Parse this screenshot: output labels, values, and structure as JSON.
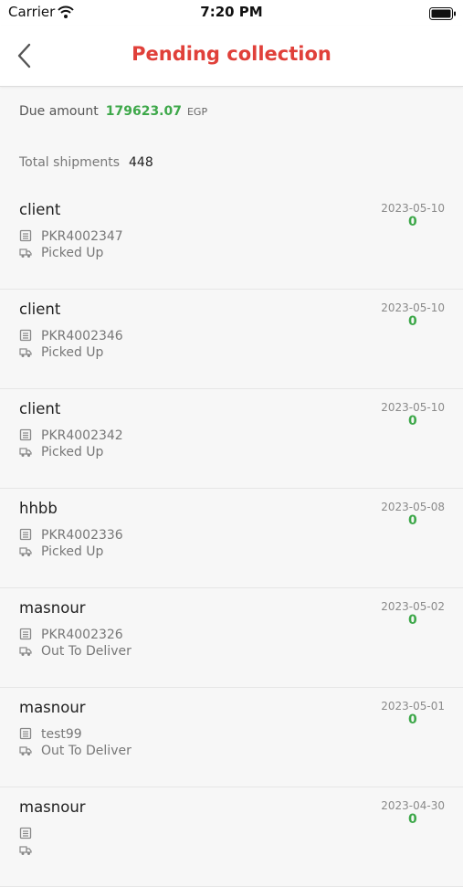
{
  "status_bar": {
    "carrier": "Carrier",
    "time": "7:20 PM"
  },
  "header": {
    "title": "Pending collection"
  },
  "summary": {
    "due_label": "Due amount",
    "due_value": "179623.07",
    "due_currency": "EGP",
    "total_label": "Total shipments",
    "total_value": "448"
  },
  "shipments": [
    {
      "client": "client",
      "code": "PKR4002347",
      "status": "Picked Up",
      "date": "2023-05-10",
      "amount": "0"
    },
    {
      "client": "client",
      "code": "PKR4002346",
      "status": "Picked Up",
      "date": "2023-05-10",
      "amount": "0"
    },
    {
      "client": "client",
      "code": "PKR4002342",
      "status": "Picked Up",
      "date": "2023-05-10",
      "amount": "0"
    },
    {
      "client": "hhbb",
      "code": "PKR4002336",
      "status": "Picked Up",
      "date": "2023-05-08",
      "amount": "0"
    },
    {
      "client": "masnour",
      "code": "PKR4002326",
      "status": "Out To Deliver",
      "date": "2023-05-02",
      "amount": "0"
    },
    {
      "client": "masnour",
      "code": "test99",
      "status": "Out To Deliver",
      "date": "2023-05-01",
      "amount": "0"
    },
    {
      "client": "masnour",
      "code": "",
      "status": "",
      "date": "2023-04-30",
      "amount": "0"
    }
  ],
  "colors": {
    "accent_red": "#e0403a",
    "money_green": "#3ea84a"
  },
  "icons": {
    "code": "list-icon",
    "status": "truck-icon",
    "back": "chevron-left-icon"
  }
}
